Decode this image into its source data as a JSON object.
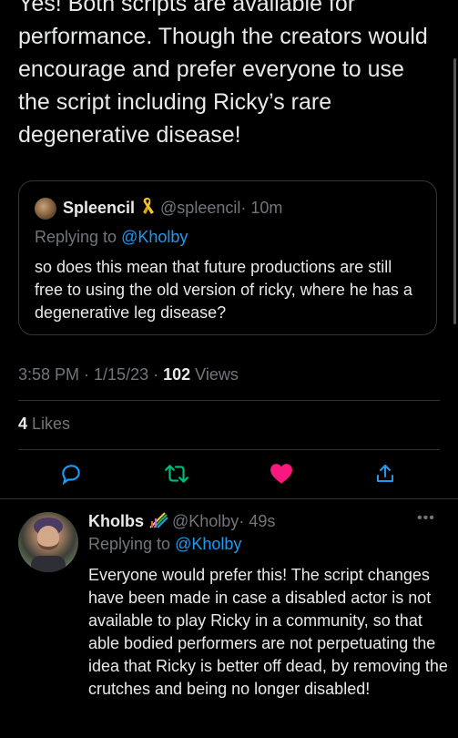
{
  "tweet": {
    "text": "Yes! Both scripts are available for performance. Though the creators would encourage and prefer everyone to use the script including Ricky’s rare degenerative disease!",
    "time": "3:58 PM · 1/15/23 · ",
    "views_count": "102",
    "views_label": " Views",
    "likes_count": "4",
    "likes_label": " Likes"
  },
  "quote": {
    "name": "Spleencil",
    "handle": "@spleencil",
    "time": " · 10m",
    "replying_prefix": "Replying to ",
    "replying_to": "@Kholby",
    "text": "so does this mean that future productions are still free to using the old version of ricky, where he has a degenerative leg disease?"
  },
  "reply": {
    "name": "Kholbs",
    "handle": "@Kholby",
    "time": " · 49s",
    "replying_prefix": "Replying to ",
    "replying_to": "@Kholby",
    "text": "Everyone would prefer this! The script changes have been made in case a disabled actor is not available to play Ricky in a community, so that able bodied performers are not perpetuating the idea that Ricky is better off dead, by removing the crutches and being no longer disabled!",
    "more": "•••"
  },
  "actions": {
    "reply_icon": "reply-icon",
    "retweet_icon": "retweet-icon",
    "like_icon": "heart-icon",
    "share_icon": "share-icon"
  },
  "colors": {
    "background": "#000000",
    "link": "#1d9bf0",
    "muted": "#71767b",
    "like": "#f91880"
  }
}
